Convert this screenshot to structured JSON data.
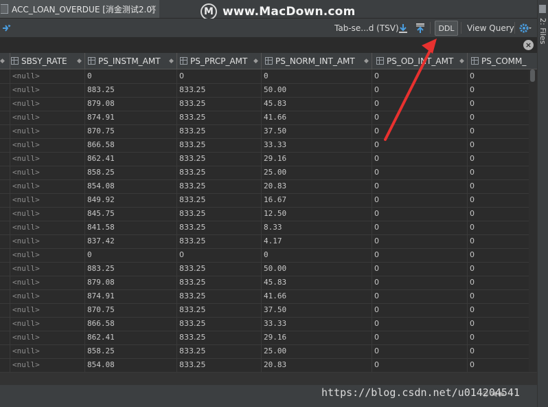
{
  "tab": {
    "title": "ACC_LOAN_OVERDUE [消金测试2.0]",
    "close": "×"
  },
  "watermark": {
    "logo_letter": "M",
    "site": "www.MacDown.com",
    "url": "https://blog.csdn.net/u014204541"
  },
  "toolbar": {
    "format_select": "Tab-se...d (TSV)",
    "ddl_label": "DDL",
    "view_query_label": "View Query"
  },
  "side_panel": {
    "label": "2: Files"
  },
  "columns": [
    "SBSY_RATE",
    "PS_INSTM_AMT",
    "PS_PRCP_AMT",
    "PS_NORM_INT_AMT",
    "PS_OD_INT_AMT",
    "PS_COMM_"
  ],
  "rows": [
    [
      "<null>",
      "0",
      "0",
      "0",
      "0",
      "0"
    ],
    [
      "<null>",
      "883.25",
      "833.25",
      "50.00",
      "0",
      "0"
    ],
    [
      "<null>",
      "879.08",
      "833.25",
      "45.83",
      "0",
      "0"
    ],
    [
      "<null>",
      "874.91",
      "833.25",
      "41.66",
      "0",
      "0"
    ],
    [
      "<null>",
      "870.75",
      "833.25",
      "37.50",
      "0",
      "0"
    ],
    [
      "<null>",
      "866.58",
      "833.25",
      "33.33",
      "0",
      "0"
    ],
    [
      "<null>",
      "862.41",
      "833.25",
      "29.16",
      "0",
      "0"
    ],
    [
      "<null>",
      "858.25",
      "833.25",
      "25.00",
      "0",
      "0"
    ],
    [
      "<null>",
      "854.08",
      "833.25",
      "20.83",
      "0",
      "0"
    ],
    [
      "<null>",
      "849.92",
      "833.25",
      "16.67",
      "0",
      "0"
    ],
    [
      "<null>",
      "845.75",
      "833.25",
      "12.50",
      "0",
      "0"
    ],
    [
      "<null>",
      "841.58",
      "833.25",
      "8.33",
      "0",
      "0"
    ],
    [
      "<null>",
      "837.42",
      "833.25",
      "4.17",
      "0",
      "0"
    ],
    [
      "<null>",
      "0",
      "0",
      "0",
      "0",
      "0"
    ],
    [
      "<null>",
      "883.25",
      "833.25",
      "50.00",
      "0",
      "0"
    ],
    [
      "<null>",
      "879.08",
      "833.25",
      "45.83",
      "0",
      "0"
    ],
    [
      "<null>",
      "874.91",
      "833.25",
      "41.66",
      "0",
      "0"
    ],
    [
      "<null>",
      "870.75",
      "833.25",
      "37.50",
      "0",
      "0"
    ],
    [
      "<null>",
      "866.58",
      "833.25",
      "33.33",
      "0",
      "0"
    ],
    [
      "<null>",
      "862.41",
      "833.25",
      "29.16",
      "0",
      "0"
    ],
    [
      "<null>",
      "858.25",
      "833.25",
      "25.00",
      "0",
      "0"
    ],
    [
      "<null>",
      "854.08",
      "833.25",
      "20.83",
      "0",
      "0"
    ]
  ],
  "colors": {
    "background": "#2b2b2b",
    "panel": "#3c3f41",
    "accent": "#4a9ee0",
    "arrow": "#e8312f"
  },
  "icons": [
    "filter-icon",
    "download-icon",
    "upload-icon",
    "settings-icon",
    "close-icon",
    "clear-icon",
    "file-icon"
  ]
}
